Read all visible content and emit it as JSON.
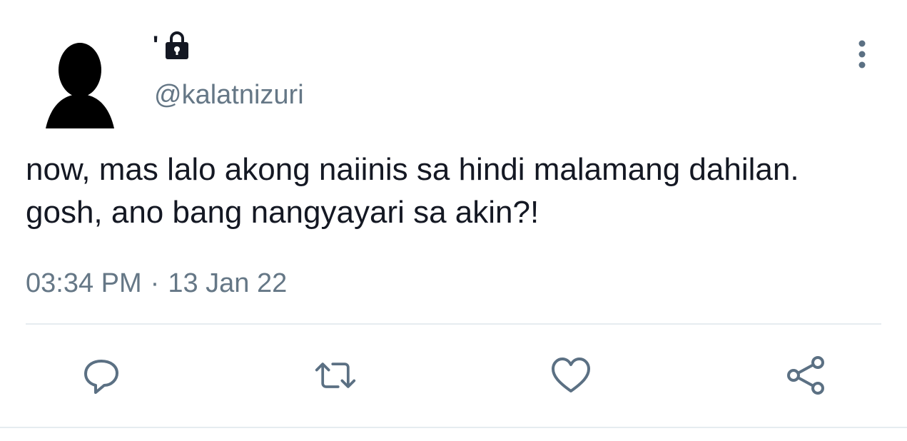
{
  "tweet": {
    "display_name": "'",
    "handle": "@kalatnizuri",
    "text": "now, mas lalo akong naiinis sa hindi malamang dahilan. gosh, ano bang nangyayari sa akin?!",
    "time": "03:34 PM",
    "separator": "·",
    "date": "13 Jan 22"
  },
  "icons": {
    "avatar": "default-user-silhouette",
    "lock": "lock-icon",
    "more": "more-vertical-icon",
    "reply": "reply-icon",
    "retweet": "retweet-icon",
    "like": "heart-icon",
    "share": "share-icon"
  },
  "colors": {
    "text": "#141823",
    "secondary": "#657786",
    "divider": "#e6ecf0",
    "icon": "#5b7083"
  }
}
